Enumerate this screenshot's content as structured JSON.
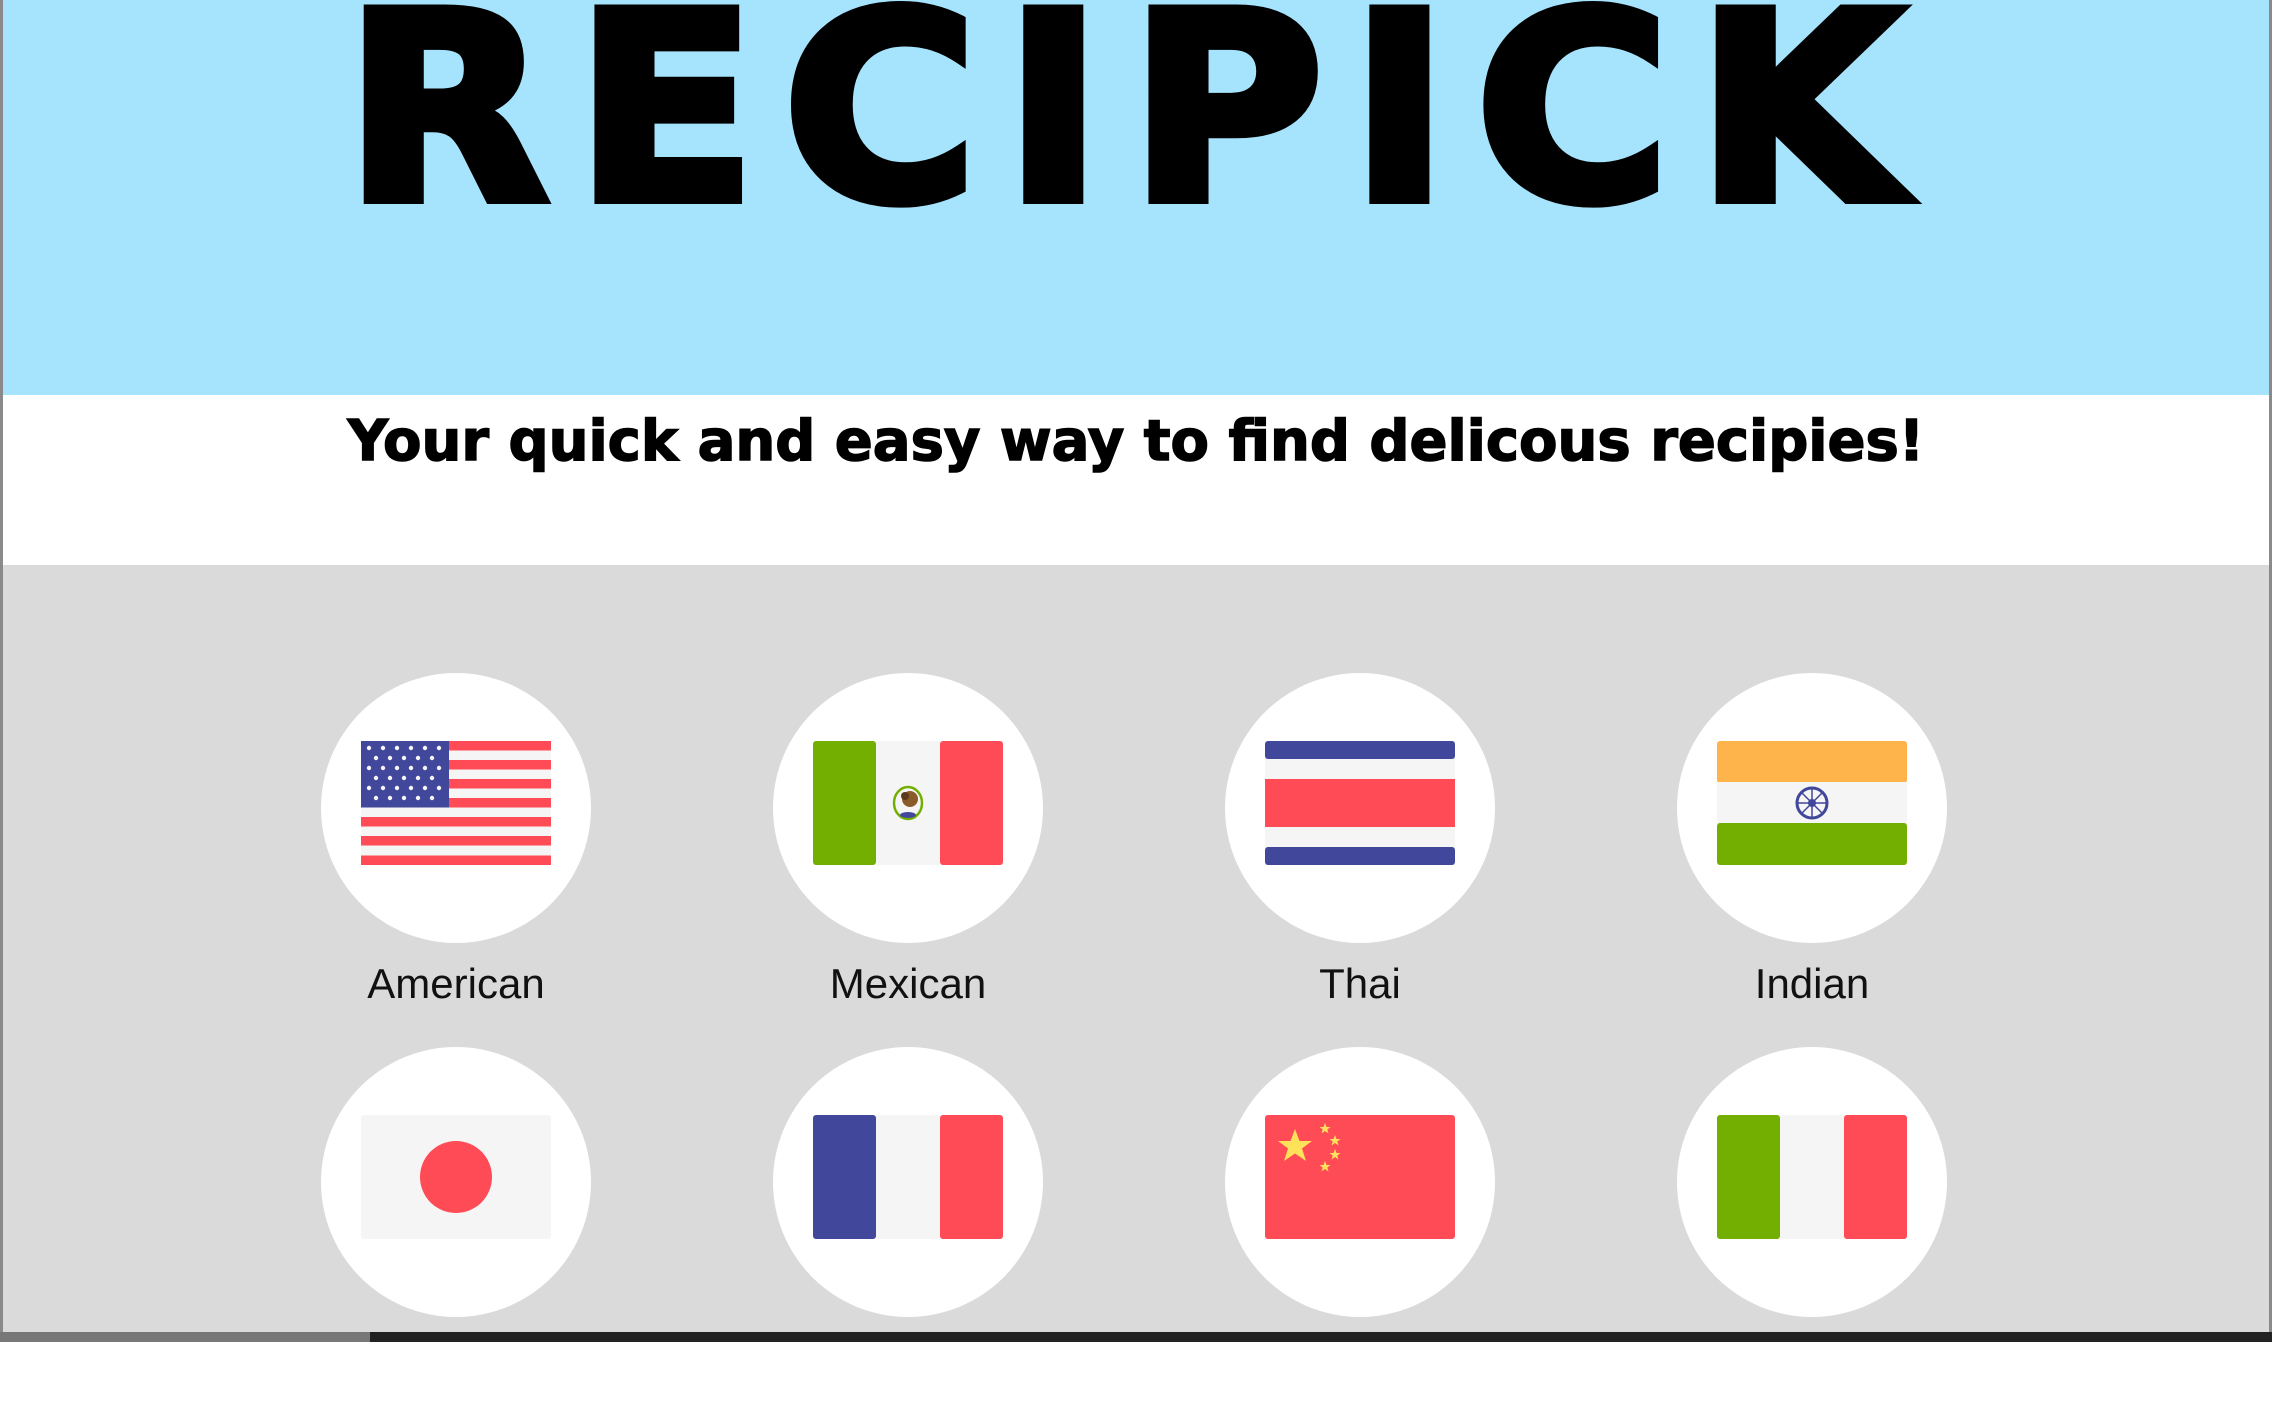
{
  "app": {
    "title": "RECIPICK"
  },
  "tagline": "Your quick and easy way to find delicous recipies!",
  "colors": {
    "header_bg": "#a6e4fe",
    "grid_bg": "#dadada",
    "flag_red": "#ff4b55",
    "flag_blue": "#41479b",
    "flag_green": "#73af00",
    "flag_orange": "#ffb44b",
    "flag_white": "#f5f5f5"
  },
  "cuisines": [
    {
      "label": "American",
      "flag": "usa-flag-icon"
    },
    {
      "label": "Mexican",
      "flag": "mexico-flag-icon"
    },
    {
      "label": "Thai",
      "flag": "thailand-flag-icon"
    },
    {
      "label": "Indian",
      "flag": "india-flag-icon"
    },
    {
      "label": "",
      "flag": "japan-flag-icon"
    },
    {
      "label": "",
      "flag": "france-flag-icon"
    },
    {
      "label": "",
      "flag": "china-flag-icon"
    },
    {
      "label": "",
      "flag": "italy-flag-icon"
    }
  ]
}
